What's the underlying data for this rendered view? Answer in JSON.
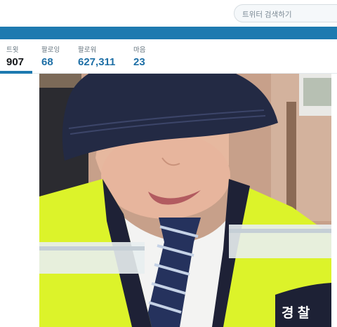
{
  "search": {
    "placeholder": "트위터 검색하기"
  },
  "stats": [
    {
      "label": "트윗",
      "value": "907",
      "active": true
    },
    {
      "label": "팔로잉",
      "value": "68"
    },
    {
      "label": "팔로워",
      "value": "627,311"
    },
    {
      "label": "마음",
      "value": "23"
    }
  ],
  "photo": {
    "badge_text": "경 찰"
  },
  "colors": {
    "accent": "#1e7ab0",
    "vest": "#dcf32a",
    "cap": "#232a44"
  }
}
